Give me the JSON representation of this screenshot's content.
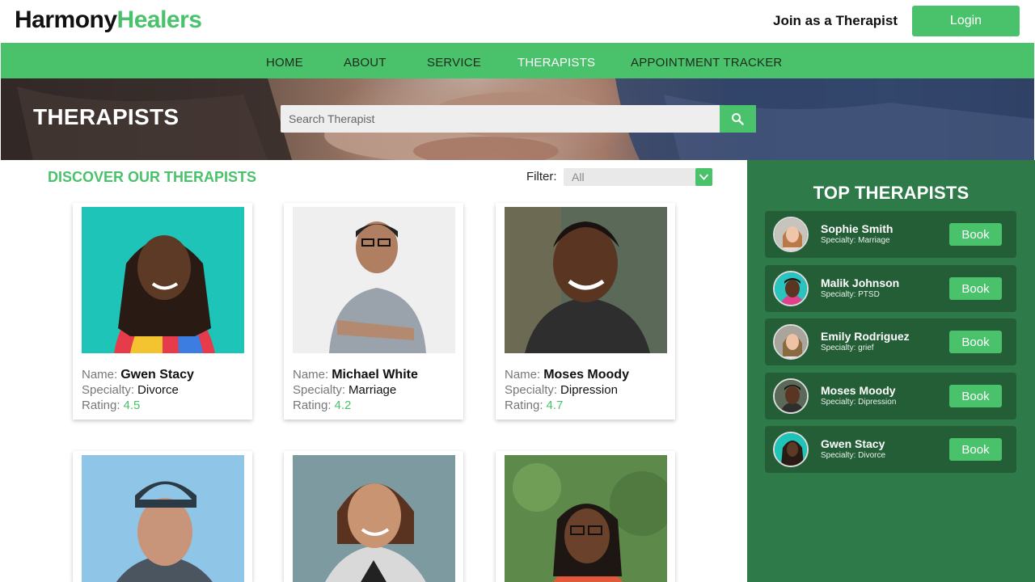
{
  "brand": {
    "part1": "Harmony",
    "part2": "Healers"
  },
  "header": {
    "join_label": "Join as a Therapist",
    "login_label": "Login"
  },
  "nav": [
    "HOME",
    "ABOUT",
    "SERVICE",
    "THERAPISTS",
    "APPOINTMENT TRACKER"
  ],
  "nav_active": "THERAPISTS",
  "banner": {
    "title": "THERAPISTS",
    "search_placeholder": "Search Therapist"
  },
  "main": {
    "heading": "DISCOVER OUR THERAPISTS",
    "filter_label": "Filter:",
    "filter_value": "All",
    "field_labels": {
      "name": "Name:",
      "specialty": "Specialty:",
      "rating": "Rating:"
    },
    "cards": [
      {
        "name": "Gwen Stacy",
        "specialty": "Divorce",
        "rating": "4.5"
      },
      {
        "name": "Michael White",
        "specialty": "Marriage",
        "rating": "4.2"
      },
      {
        "name": "Moses Moody",
        "specialty": "Dipression",
        "rating": "4.7"
      },
      {
        "name": "",
        "specialty": "",
        "rating": ""
      },
      {
        "name": "",
        "specialty": "",
        "rating": ""
      },
      {
        "name": "",
        "specialty": "",
        "rating": ""
      }
    ]
  },
  "sidebar": {
    "title": "TOP THERAPISTS",
    "book_label": "Book",
    "items": [
      {
        "name": "Sophie Smith",
        "specialty": "Specialty: Marriage"
      },
      {
        "name": "Malik Johnson",
        "specialty": "Specialty: PTSD"
      },
      {
        "name": "Emily Rodriguez",
        "specialty": "Specialty: grief"
      },
      {
        "name": "Moses Moody",
        "specialty": "Specialty: Dipression"
      },
      {
        "name": "Gwen Stacy",
        "specialty": "Specialty: Divorce"
      }
    ]
  },
  "colors": {
    "accent": "#4ac26b",
    "sidebar_bg": "#2f7a49",
    "sidebar_item_bg": "#235e37"
  }
}
